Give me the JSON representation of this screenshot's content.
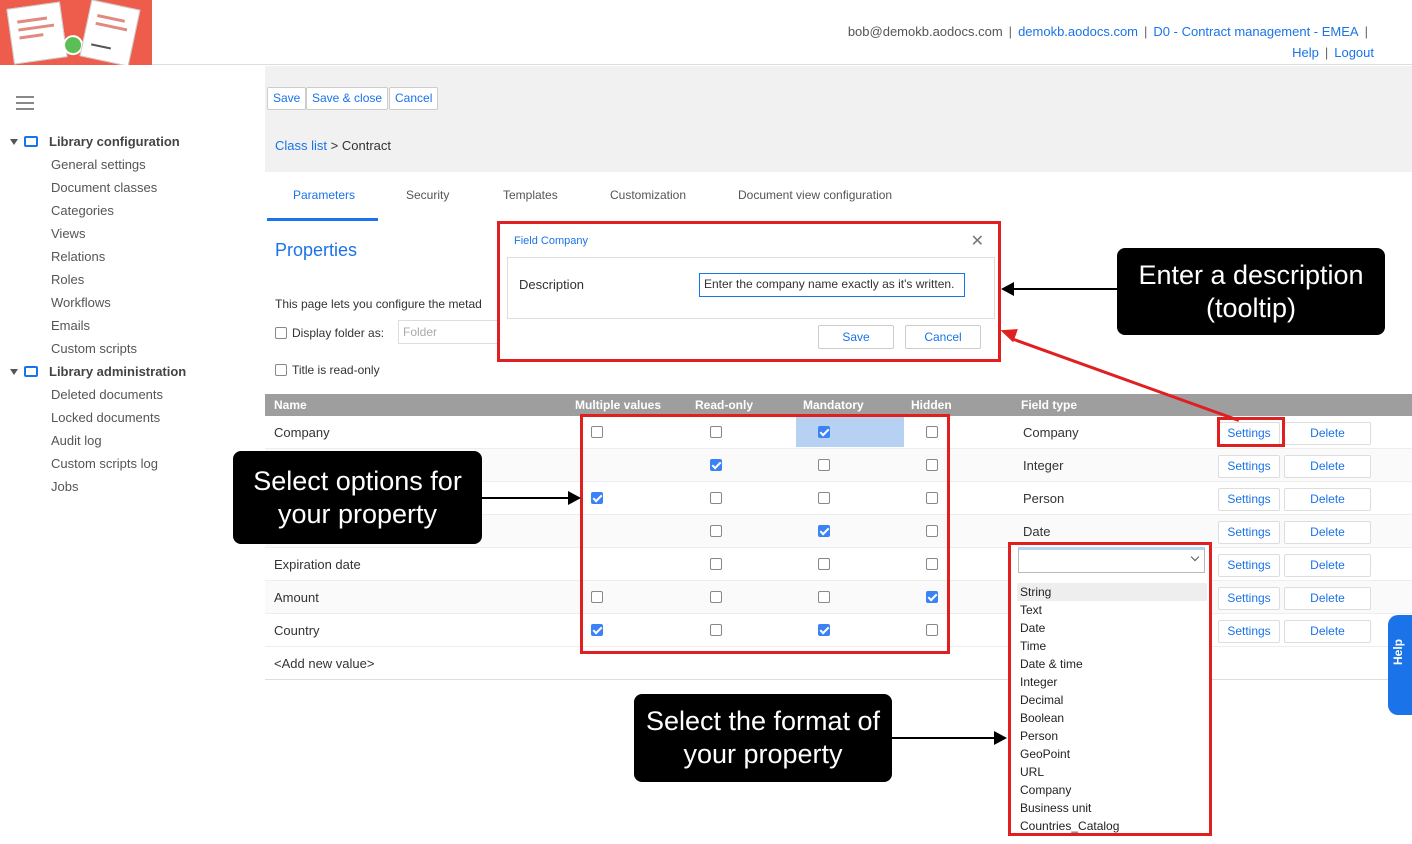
{
  "header": {
    "user_email": "bob@demokb.aodocs.com",
    "domain": "demokb.aodocs.com",
    "library": "D0 - Contract management - EMEA",
    "help": "Help",
    "logout": "Logout"
  },
  "sidebar": {
    "section1": "Library configuration",
    "items1": [
      "General settings",
      "Document classes",
      "Categories",
      "Views",
      "Relations",
      "Roles",
      "Workflows",
      "Emails",
      "Custom scripts"
    ],
    "section2": "Library administration",
    "items2": [
      "Deleted documents",
      "Locked documents",
      "Audit log",
      "Custom scripts log",
      "Jobs"
    ]
  },
  "toolbar": {
    "save": "Save",
    "save_close": "Save & close",
    "cancel": "Cancel"
  },
  "breadcrumb": {
    "link": "Class list",
    "sep": ">",
    "current": "Contract"
  },
  "tabs": [
    "Parameters",
    "Security",
    "Templates",
    "Customization",
    "Document view configuration"
  ],
  "properties": {
    "title": "Properties",
    "description": "This page lets you configure the metad",
    "display_folder_label": "Display folder as:",
    "folder_placeholder": "Folder",
    "title_readonly_label": "Title is read-only"
  },
  "table": {
    "headers": [
      "Name",
      "Multiple values",
      "Read-only",
      "Mandatory",
      "Hidden",
      "Field type"
    ],
    "settings_label": "Settings",
    "delete_label": "Delete",
    "add_new": "<Add new value>",
    "rows": [
      {
        "name": "Company",
        "type": "Company",
        "multiple": false,
        "readonly": false,
        "mandatory": true,
        "hidden": false
      },
      {
        "name": "",
        "type": "Integer",
        "multiple": null,
        "readonly": true,
        "mandatory": false,
        "hidden": false
      },
      {
        "name": "",
        "type": "Person",
        "multiple": true,
        "readonly": false,
        "mandatory": false,
        "hidden": false
      },
      {
        "name": "",
        "type": "Date",
        "multiple": null,
        "readonly": false,
        "mandatory": true,
        "hidden": false
      },
      {
        "name": "Expiration date",
        "type": "",
        "multiple": null,
        "readonly": false,
        "mandatory": false,
        "hidden": false
      },
      {
        "name": "Amount",
        "type": "",
        "multiple": false,
        "readonly": false,
        "mandatory": false,
        "hidden": true
      },
      {
        "name": "Country",
        "type": "",
        "multiple": true,
        "readonly": false,
        "mandatory": true,
        "hidden": false
      }
    ]
  },
  "field_type_dropdown": {
    "options": [
      "String",
      "Text",
      "Date",
      "Time",
      "Date & time",
      "Integer",
      "Decimal",
      "Boolean",
      "Person",
      "GeoPoint",
      "URL",
      "Company",
      "Business unit",
      "Countries_Catalog"
    ]
  },
  "dialog": {
    "title": "Field Company",
    "label": "Description",
    "value": "Enter the company name exactly as it's written.",
    "save": "Save",
    "cancel": "Cancel"
  },
  "callouts": {
    "description": "Enter a description (tooltip)",
    "options": "Select options for your property",
    "format": "Select the format of your property"
  },
  "help_tab": "Help",
  "colors": {
    "accent": "#1a73e8",
    "highlight": "#e02020",
    "logo": "#ee5c4c",
    "callout": "#000000"
  }
}
